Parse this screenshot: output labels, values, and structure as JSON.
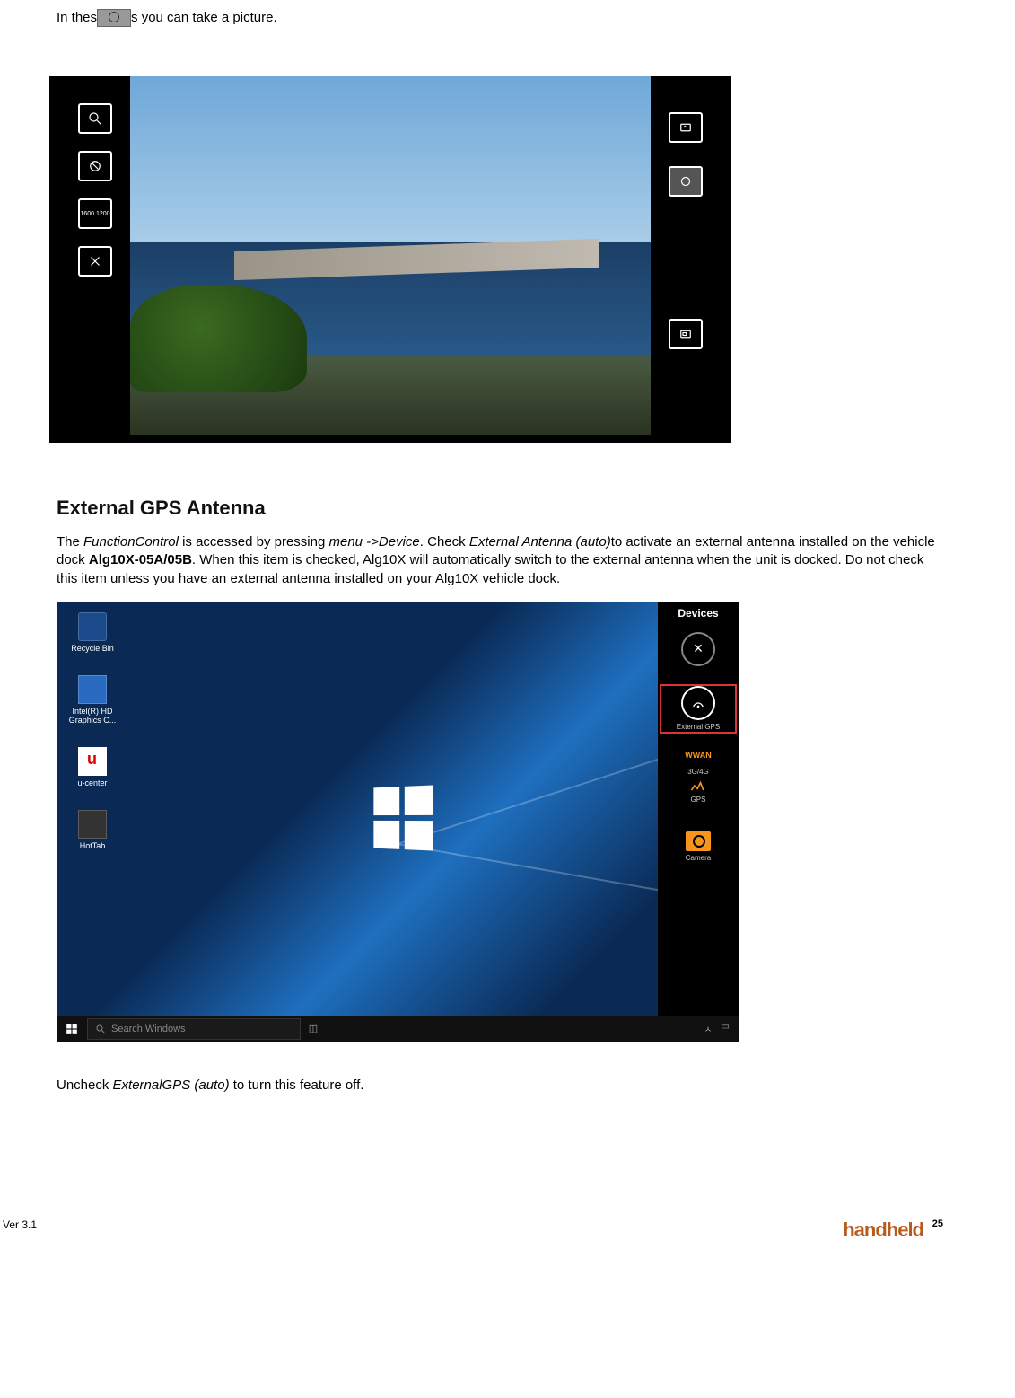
{
  "intro": {
    "prefix": "In thes",
    "suffix": "s you can take a picture."
  },
  "camera_ui": {
    "left_buttons": [
      {
        "name": "zoom-icon",
        "label": ""
      },
      {
        "name": "flash-icon",
        "label": ""
      },
      {
        "name": "resolution-icon",
        "label": "1600 1200"
      },
      {
        "name": "cancel-icon",
        "label": ""
      }
    ],
    "right_buttons": [
      {
        "name": "switch-camera-icon",
        "label": ""
      },
      {
        "name": "shutter-icon",
        "label": ""
      },
      {
        "name": "gallery-icon",
        "label": ""
      }
    ]
  },
  "section": {
    "heading": "External GPS Antenna",
    "p1_a": "The ",
    "p1_b": "FunctionControl",
    "p1_c": " is accessed by pressing ",
    "p1_d": "menu ->Device",
    "p1_e": ". Check ",
    "p1_f": "External Antenna (auto)",
    "p1_g": "to activate an external antenna installed on the vehicle dock ",
    "p1_h": "Alg10X-05A/05B",
    "p1_i": ". When this item is checked, Alg10X will automatically switch to the external antenna when the unit is docked. Do not check this item unless you have an external antenna installed on your Alg10X vehicle dock."
  },
  "desktop": {
    "icons": [
      {
        "key": "recycle",
        "label": "Recycle Bin"
      },
      {
        "key": "intel",
        "label": "Intel(R) HD Graphics C..."
      },
      {
        "key": "ucenter",
        "label": "u-center"
      },
      {
        "key": "hottab",
        "label": "HotTab"
      }
    ],
    "devices_panel": {
      "title": "Devices",
      "close": "×",
      "items": [
        {
          "key": "ext-gps",
          "label": "External GPS",
          "selected": true
        },
        {
          "key": "wwan-h",
          "label": "WWAN",
          "orange": true
        },
        {
          "key": "wwan",
          "label": "3G/4G"
        },
        {
          "key": "gps",
          "label": "GPS"
        },
        {
          "key": "camera",
          "label": "Camera",
          "cam": true
        }
      ]
    },
    "taskbar": {
      "search_placeholder": "Search Windows",
      "tray": [
        "ㅅ",
        "▭"
      ]
    }
  },
  "uncheck": {
    "a": "Uncheck ",
    "b": "ExternalGPS (auto)",
    "c": " to turn this feature off."
  },
  "footer": {
    "version": "Ver 3.1",
    "logo": "handheld",
    "page": "25"
  }
}
